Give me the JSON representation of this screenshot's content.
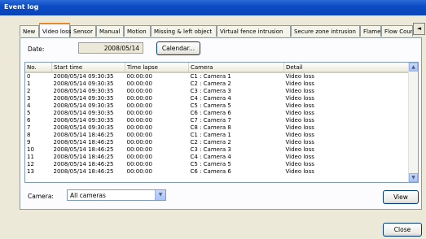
{
  "window": {
    "title": "Event log"
  },
  "tabs": [
    "New",
    "Video loss",
    "Sensor",
    "Manual",
    "Motion",
    "Missing & left object",
    "Virtual fence intrusion",
    "Secure zone intrusion",
    "Flame",
    "Flow Counts"
  ],
  "date": {
    "label": "Date:",
    "value": "2008/05/14",
    "button": "Calendar..."
  },
  "table": {
    "columns": [
      "No.",
      "Start time",
      "Time lapse",
      "Camera",
      "Detail"
    ],
    "rows": [
      [
        "0",
        "2008/05/14 09:30:35",
        "00:00:00",
        "C1 : Camera 1",
        "Video loss"
      ],
      [
        "1",
        "2008/05/14 09:30:35",
        "00:00:00",
        "C2 : Camera 2",
        "Video loss"
      ],
      [
        "2",
        "2008/05/14 09:30:35",
        "00:00:00",
        "C3 : Camera 3",
        "Video loss"
      ],
      [
        "3",
        "2008/05/14 09:30:35",
        "00:00:00",
        "C4 : Camera 4",
        "Video loss"
      ],
      [
        "4",
        "2008/05/14 09:30:35",
        "00:00:00",
        "C5 : Camera 5",
        "Video loss"
      ],
      [
        "5",
        "2008/05/14 09:30:35",
        "00:00:00",
        "C6 : Camera 6",
        "Video loss"
      ],
      [
        "6",
        "2008/05/14 09:30:35",
        "00:00:00",
        "C7 : Camera 7",
        "Video loss"
      ],
      [
        "7",
        "2008/05/14 09:30:35",
        "00:00:00",
        "C8 : Camera 8",
        "Video loss"
      ],
      [
        "8",
        "2008/05/14 18:46:25",
        "00:00:00",
        "C1 : Camera 1",
        "Video loss"
      ],
      [
        "9",
        "2008/05/14 18:46:25",
        "00:00:00",
        "C2 : Camera 2",
        "Video loss"
      ],
      [
        "10",
        "2008/05/14 18:46:25",
        "00:00:00",
        "C3 : Camera 3",
        "Video loss"
      ],
      [
        "11",
        "2008/05/14 18:46:25",
        "00:00:00",
        "C4 : Camera 4",
        "Video loss"
      ],
      [
        "12",
        "2008/05/14 18:46:25",
        "00:00:00",
        "C5 : Camera 5",
        "Video loss"
      ],
      [
        "13",
        "2008/05/14 18:46:25",
        "00:00:00",
        "C6 : Camera 6",
        "Video loss"
      ]
    ]
  },
  "camera": {
    "label": "Camera:",
    "value": "All cameras"
  },
  "buttons": {
    "view": "View",
    "close": "Close"
  },
  "colors": {
    "title_bar": "#0b4cc4",
    "active_tab_accent": "#e68b2c"
  }
}
